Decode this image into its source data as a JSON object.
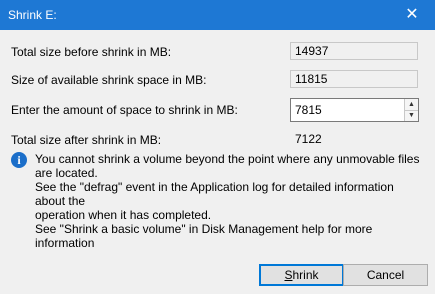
{
  "window": {
    "title": "Shrink E:"
  },
  "fields": {
    "total_before_label": "Total size before shrink in MB:",
    "total_before_value": "14937",
    "available_label": "Size of available shrink space in MB:",
    "available_value": "11815",
    "amount_label": "Enter the amount of space to shrink in MB:",
    "amount_value": "7815",
    "total_after_label": "Total size after shrink in MB:",
    "total_after_value": "7122"
  },
  "info": {
    "icon": "info-icon",
    "text": "You cannot shrink a volume beyond the point where any unmovable files are located.\nSee the \"defrag\" event in the Application log for detailed information about the\noperation when it has completed."
  },
  "help": {
    "text": "See \"Shrink a basic volume\" in Disk Management help for more information"
  },
  "buttons": {
    "shrink_mnemonic": "S",
    "shrink_rest": "hrink",
    "cancel": "Cancel"
  },
  "colors": {
    "title_bar": "#1e78d4",
    "default_button_border": "#0078d7"
  }
}
